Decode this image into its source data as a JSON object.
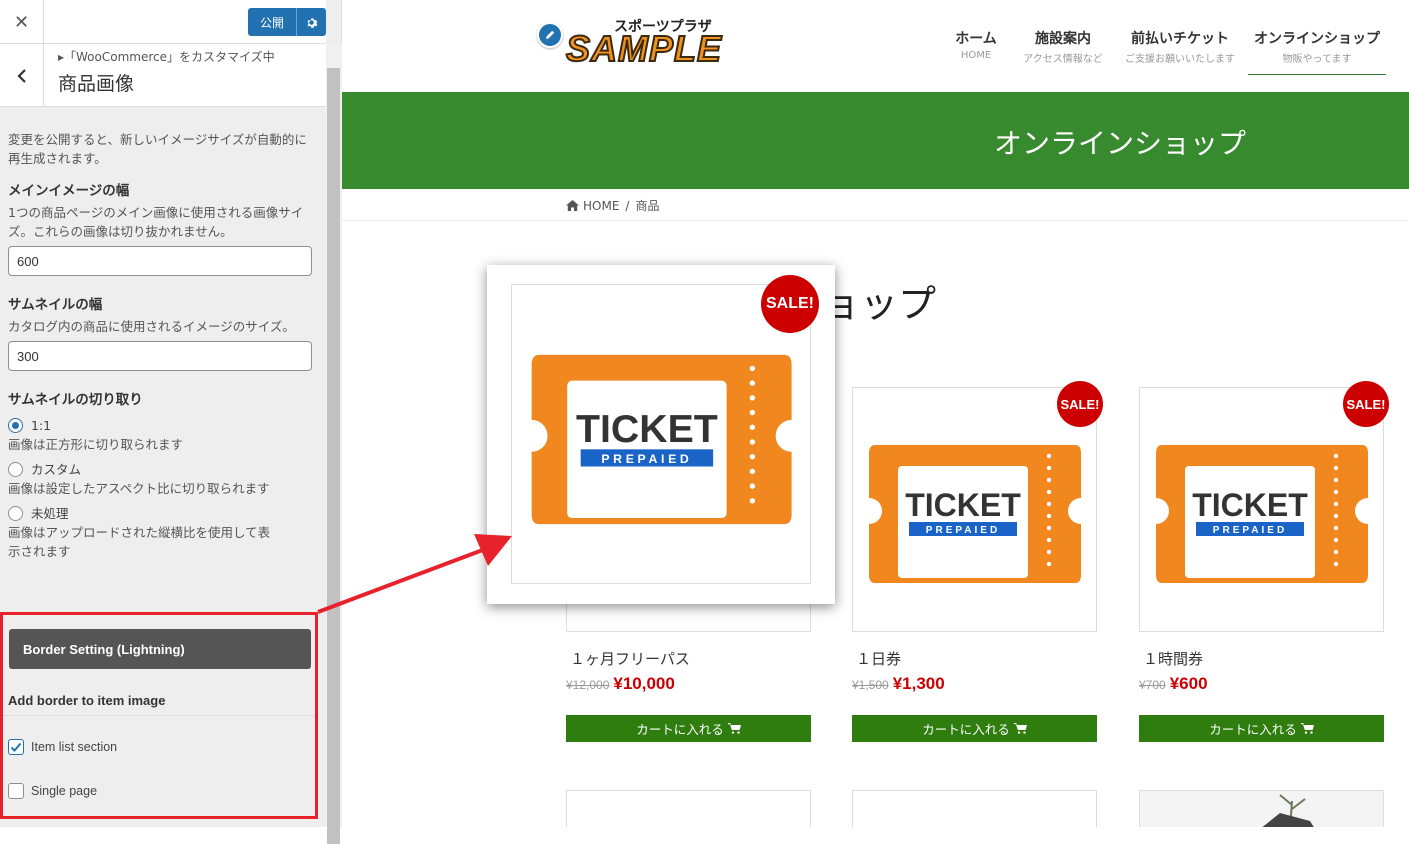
{
  "sidebar": {
    "publish_label": "公開",
    "breadcrumb": "▸「WooCommerce」をカスタマイズ中",
    "title": "商品画像",
    "intro": "変更を公開すると、新しいイメージサイズが自動的に再生成されます。",
    "main_width": {
      "title": "メインイメージの幅",
      "desc": "1つの商品ページのメイン画像に使用される画像サイズ。これらの画像は切り抜かれません。",
      "value": "600"
    },
    "thumb_width": {
      "title": "サムネイルの幅",
      "desc": "カタログ内の商品に使用されるイメージのサイズ。",
      "value": "300"
    },
    "crop": {
      "title": "サムネイルの切り取り",
      "options": [
        {
          "label": "1:1",
          "desc": "画像は正方形に切り取られます",
          "checked": true
        },
        {
          "label": "カスタム",
          "desc": "画像は設定したアスペクト比に切り取られます",
          "checked": false
        },
        {
          "label": "未処理",
          "desc": "画像はアップロードされた縦横比を使用して表示されます",
          "checked": false
        }
      ]
    },
    "border": {
      "button": "Border Setting (Lightning)",
      "subtitle": "Add border to item image",
      "item_list": "Item list section",
      "single_page": "Single page",
      "item_list_checked": true,
      "single_page_checked": false
    }
  },
  "site": {
    "logo_small": "スポーツプラザ",
    "logo_big": "SAMPLE",
    "nav": [
      {
        "main": "ホーム",
        "sub": "HOME"
      },
      {
        "main": "施設案内",
        "sub": "アクセス情報など"
      },
      {
        "main": "前払いチケット",
        "sub": "ご支援お願いいたします"
      },
      {
        "main": "オンラインショップ",
        "sub": "物販やってます"
      }
    ],
    "banner_title": "オンラインショップ",
    "breadcrumb": {
      "home": "HOME",
      "sep": "/",
      "current": "商品"
    },
    "heading_visible": "ョップ"
  },
  "products": [
    {
      "name": "１ヶ月フリーパス",
      "old_price": "¥12,000",
      "price": "¥10,000",
      "sale": "SALE!",
      "cart": "カートに入れる"
    },
    {
      "name": "１日券",
      "old_price": "¥1,500",
      "price": "¥1,300",
      "sale": "SALE!",
      "cart": "カートに入れる"
    },
    {
      "name": "１時間券",
      "old_price": "¥700",
      "price": "¥600",
      "sale": "SALE!",
      "cart": "カートに入れる"
    }
  ],
  "ticket": {
    "word": "TICKET",
    "sub": "PREPAIED"
  },
  "colors": {
    "accent": "#2271b1",
    "banner": "#378b2e",
    "cart": "#2e7d0e",
    "sale": "#cc0000",
    "highlight": "#e8222b",
    "ticket": "#f0881f"
  }
}
